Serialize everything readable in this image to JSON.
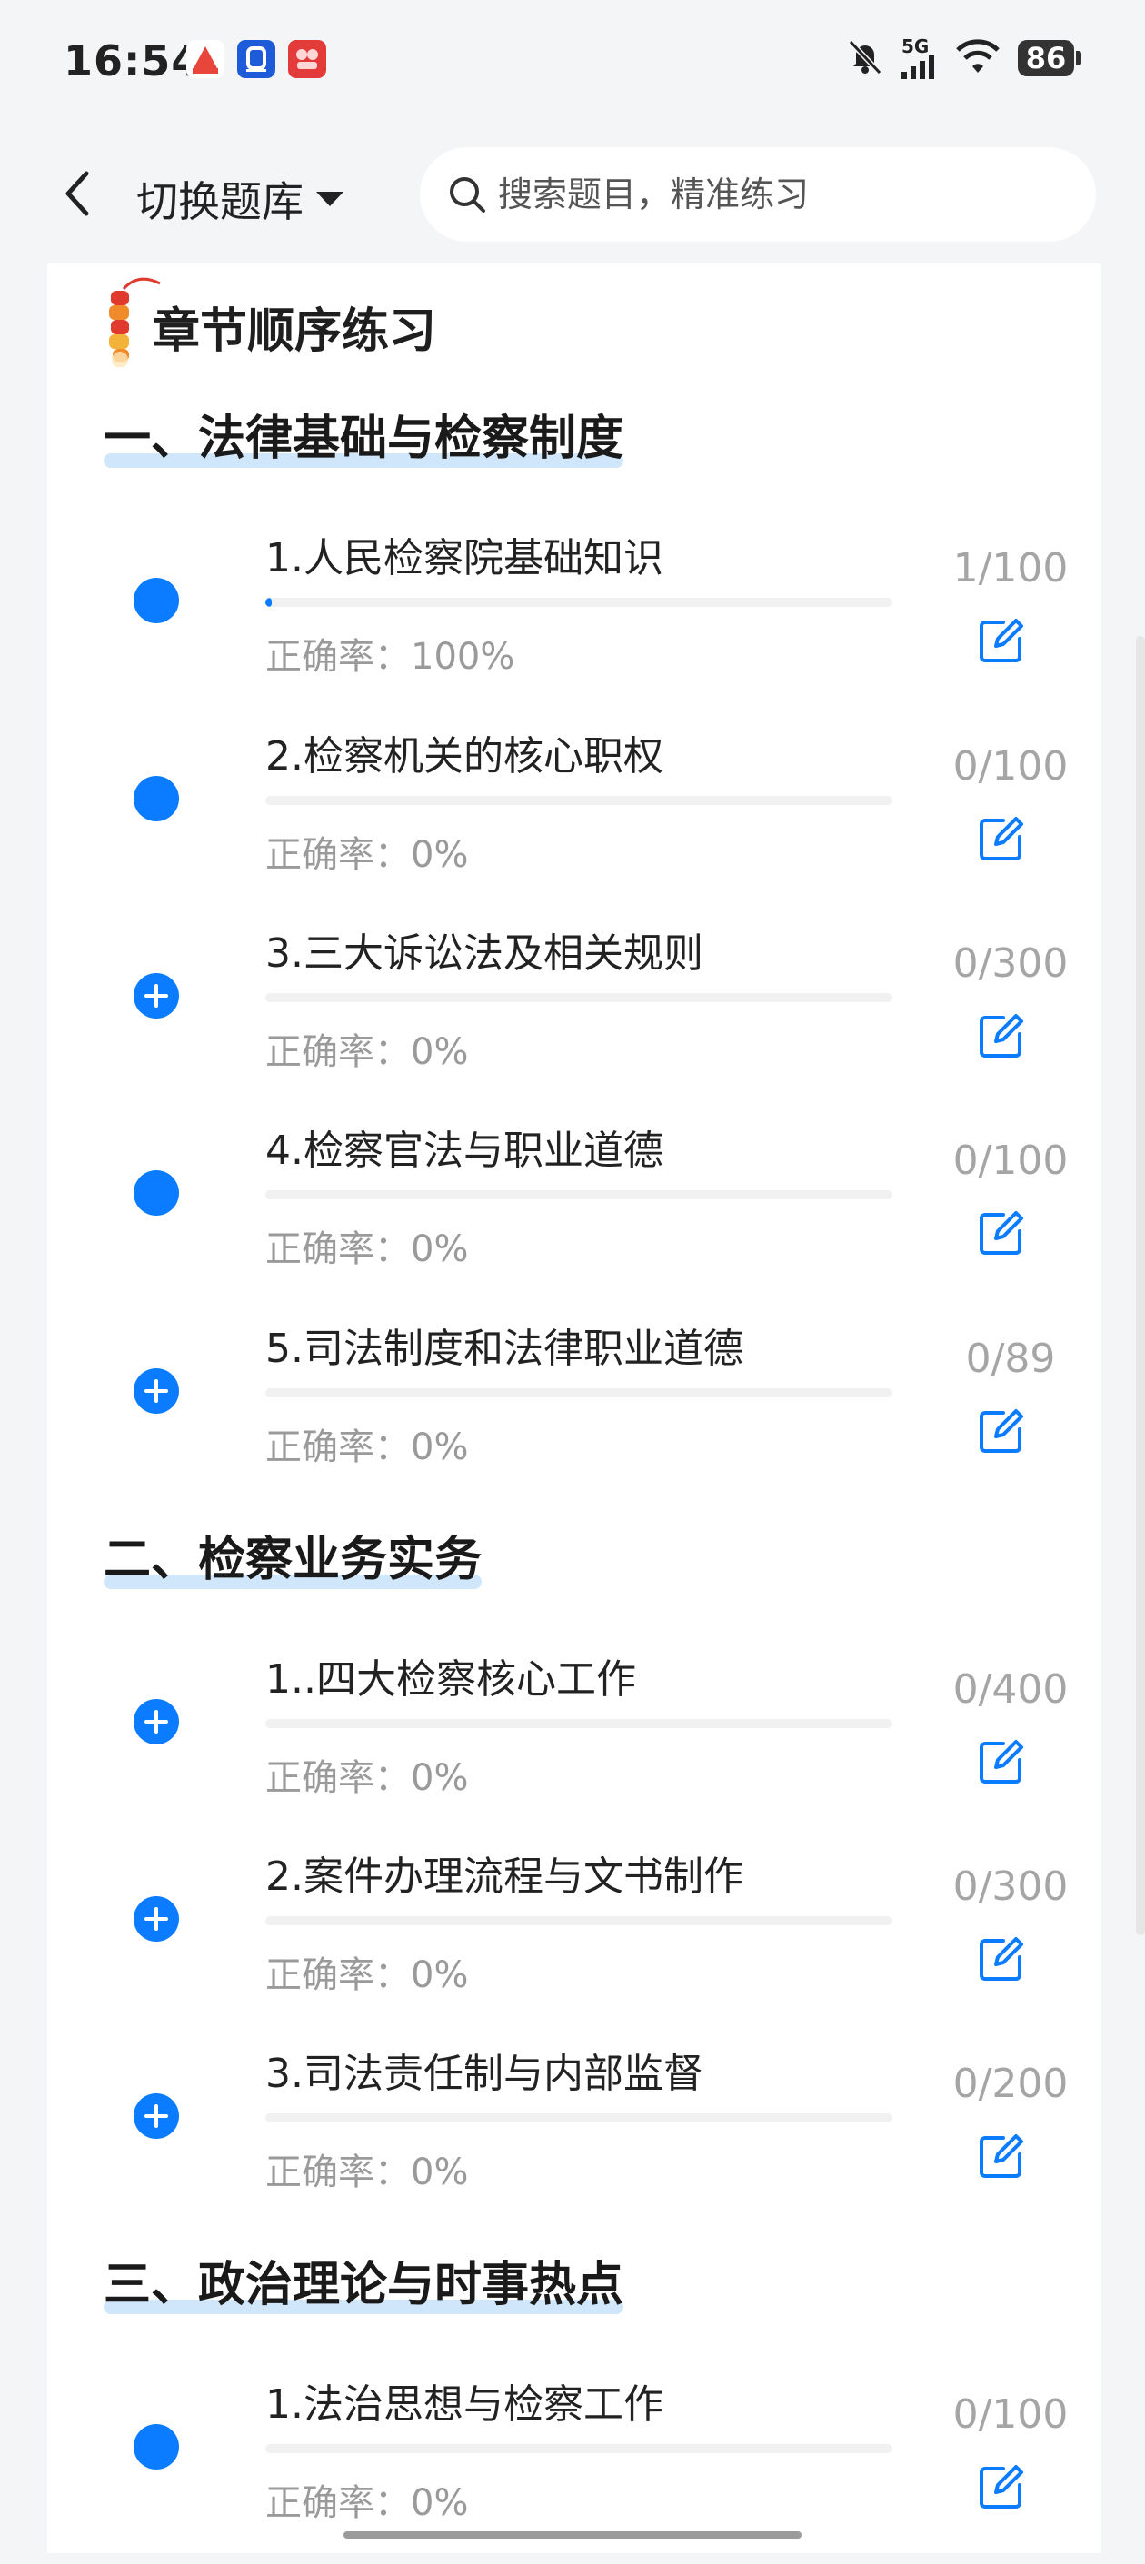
{
  "status_bar": {
    "time": "16:54",
    "network": "5G",
    "battery": "86",
    "icons": [
      "bell-off-icon",
      "signal-icon",
      "wifi-icon",
      "battery-icon"
    ],
    "apps": [
      {
        "name": "app-icon-1",
        "color": "#e8463a"
      },
      {
        "name": "app-icon-2",
        "color": "#1d5bd8"
      },
      {
        "name": "app-icon-3",
        "color": "#e33a3a"
      }
    ]
  },
  "nav": {
    "back_icon": "chevron-left-icon",
    "switch_label": "切换题库",
    "search_placeholder": "搜索题目，精准练习"
  },
  "page": {
    "heading": "章节顺序练习",
    "accent": "#0b7cff"
  },
  "sections": [
    {
      "title": "一、法律基础与检察制度",
      "items": [
        {
          "name": "1.人民检察院基础知识",
          "accuracy": "正确率：100%",
          "count": "1/100",
          "progress": 0.01,
          "status": "dot"
        },
        {
          "name": "2.检察机关的核心职权",
          "accuracy": "正确率：0%",
          "count": "0/100",
          "progress": 0,
          "status": "dot"
        },
        {
          "name": "3.三大诉讼法及相关规则",
          "accuracy": "正确率：0%",
          "count": "0/300",
          "progress": 0,
          "status": "add"
        },
        {
          "name": "4.检察官法与职业道德",
          "accuracy": "正确率：0%",
          "count": "0/100",
          "progress": 0,
          "status": "dot"
        },
        {
          "name": "5.司法制度和法律职业道德",
          "accuracy": "正确率：0%",
          "count": "0/89",
          "progress": 0,
          "status": "add"
        }
      ]
    },
    {
      "title": "二、检察业务实务",
      "items": [
        {
          "name": "1..四大检察核心工作",
          "accuracy": "正确率：0%",
          "count": "0/400",
          "progress": 0,
          "status": "add"
        },
        {
          "name": "2.案件办理流程与文书制作",
          "accuracy": "正确率：0%",
          "count": "0/300",
          "progress": 0,
          "status": "add"
        },
        {
          "name": "3.司法责任制与内部监督",
          "accuracy": "正确率：0%",
          "count": "0/200",
          "progress": 0,
          "status": "add"
        }
      ]
    },
    {
      "title": "三、政治理论与时事热点",
      "items": [
        {
          "name": "1.法治思想与检察工作",
          "accuracy": "正确率：0%",
          "count": "0/100",
          "progress": 0,
          "status": "dot"
        }
      ]
    }
  ]
}
